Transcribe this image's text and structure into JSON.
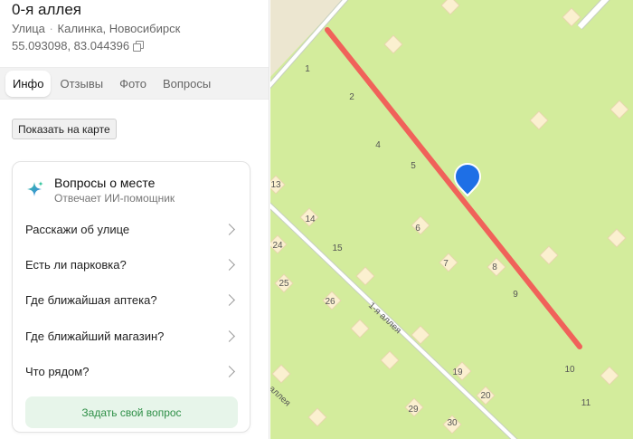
{
  "place": {
    "title": "0-я аллея",
    "type": "Улица",
    "separator": "·",
    "location": "Калинка, Новосибирск",
    "coordinates": "55.093098, 83.044396"
  },
  "tabs": [
    {
      "label": "Инфо",
      "active": true
    },
    {
      "label": "Отзывы",
      "active": false
    },
    {
      "label": "Фото",
      "active": false
    },
    {
      "label": "Вопросы",
      "active": false
    }
  ],
  "show_on_map": "Показать на карте",
  "assistant": {
    "title": "Вопросы о месте",
    "subtitle": "Отвечает ИИ-помощник",
    "questions": [
      "Расскажи об улице",
      "Есть ли парковка?",
      "Где ближайшая аптека?",
      "Где ближайший магазин?",
      "Что рядом?"
    ],
    "ask_button": "Задать свой вопрос"
  },
  "map": {
    "colors": {
      "land": "#d3ec9c",
      "building": "#fbf0d0",
      "building_edge": "#e6d6ac",
      "road": "#ffffff",
      "road_edge": "#c7cfc0",
      "highlight": "#f0625a",
      "pin": "#1e6fe6",
      "sand": "#ece6d0"
    },
    "road_name": "1-я аллея",
    "road_name_partial": "аллея",
    "house_numbers": [
      "1",
      "2",
      "4",
      "5",
      "6",
      "7",
      "8",
      "9",
      "10",
      "11",
      "13",
      "14",
      "15",
      "19",
      "20",
      "24",
      "25",
      "26",
      "29",
      "30"
    ]
  }
}
